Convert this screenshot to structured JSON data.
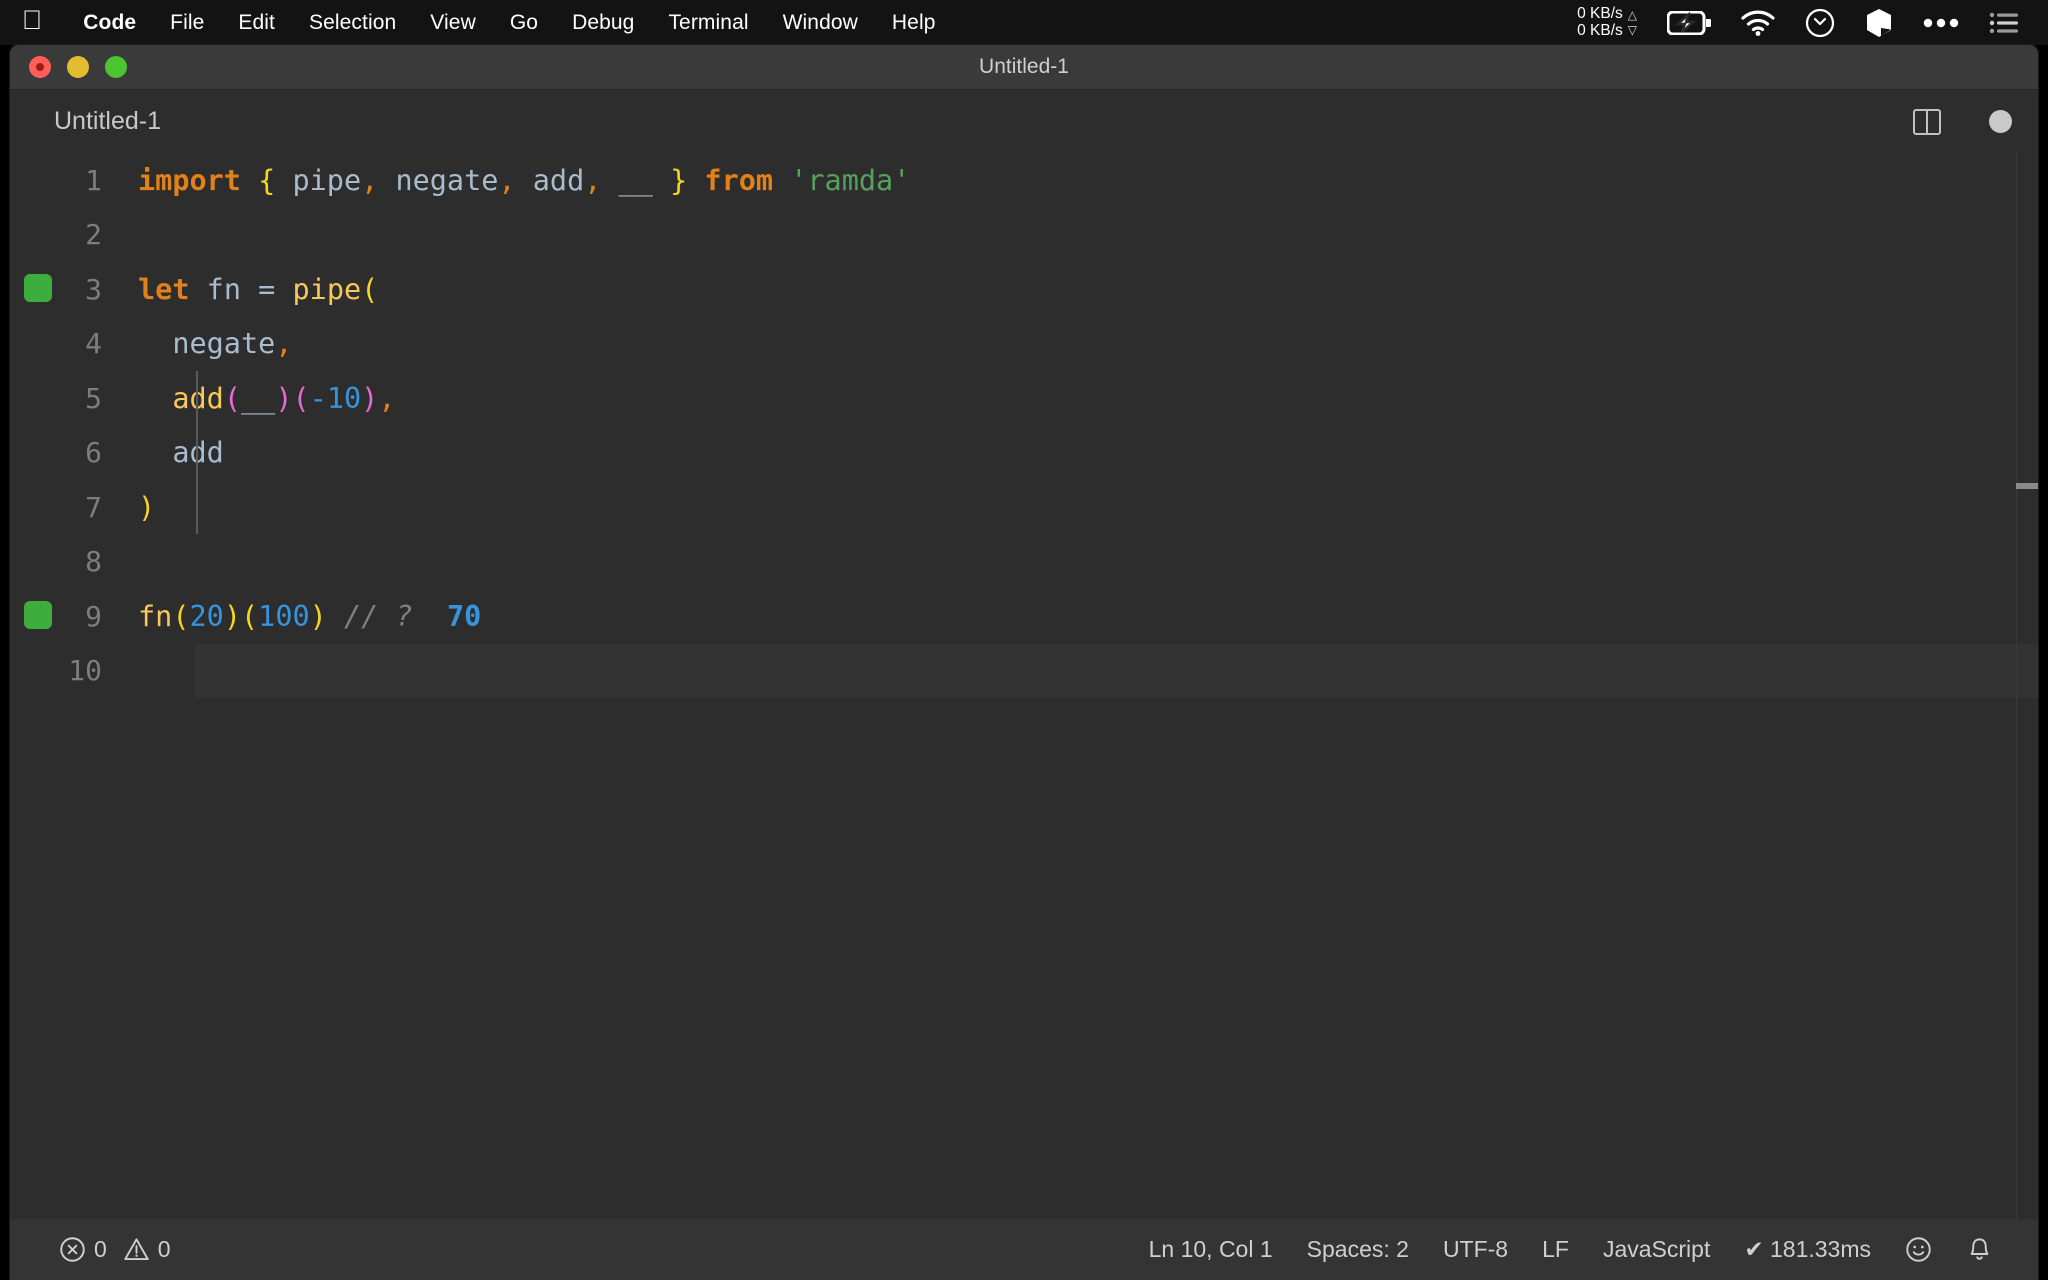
{
  "menubar": {
    "apple_icon": "apple-logo-icon",
    "items": [
      {
        "label": "Code",
        "bold": true
      },
      {
        "label": "File",
        "bold": false
      },
      {
        "label": "Edit",
        "bold": false
      },
      {
        "label": "Selection",
        "bold": false
      },
      {
        "label": "View",
        "bold": false
      },
      {
        "label": "Go",
        "bold": false
      },
      {
        "label": "Debug",
        "bold": false
      },
      {
        "label": "Terminal",
        "bold": false
      },
      {
        "label": "Window",
        "bold": false
      },
      {
        "label": "Help",
        "bold": false
      }
    ],
    "tray": {
      "net_up": "0 KB/s",
      "net_down": "0 KB/s",
      "icons": [
        "battery-charging-icon",
        "wifi-icon",
        "clock-icon",
        "box-icon",
        "ellipsis-icon",
        "control-center-icon"
      ]
    }
  },
  "window": {
    "title": "Untitled-1",
    "traffic_lights": [
      "close-button",
      "minimize-button",
      "maximize-button"
    ]
  },
  "tab": {
    "label": "Untitled-1",
    "split_icon": "split-editor-icon",
    "dirty_icon": "unsaved-dot-icon"
  },
  "editor": {
    "language": "JavaScript",
    "lines": [
      {
        "n": "1",
        "breakpoint": false,
        "active": false
      },
      {
        "n": "2",
        "breakpoint": false,
        "active": false
      },
      {
        "n": "3",
        "breakpoint": true,
        "active": false
      },
      {
        "n": "4",
        "breakpoint": false,
        "active": false
      },
      {
        "n": "5",
        "breakpoint": false,
        "active": false
      },
      {
        "n": "6",
        "breakpoint": false,
        "active": false
      },
      {
        "n": "7",
        "breakpoint": false,
        "active": false
      },
      {
        "n": "8",
        "breakpoint": false,
        "active": false
      },
      {
        "n": "9",
        "breakpoint": true,
        "active": false
      },
      {
        "n": "10",
        "breakpoint": false,
        "active": true
      }
    ],
    "code": {
      "l1": {
        "import": "import",
        "brace_open": "{",
        "pipe": "pipe",
        "c1": ",",
        "negate": "negate",
        "c2": ",",
        "add": "add",
        "c3": ",",
        "placeholder": "__",
        "brace_close": "}",
        "from": "from",
        "module": "'ramda'"
      },
      "l3": {
        "let": "let",
        "fn": "fn",
        "eq": "=",
        "pipe": "pipe",
        "paren": "("
      },
      "l4": {
        "negate": "negate",
        "comma": ","
      },
      "l5": {
        "add": "add",
        "p1": "(",
        "placeholder": "__",
        "p2": ")",
        "p3": "(",
        "num": "-10",
        "p4": ")",
        "comma": ","
      },
      "l6": {
        "add": "add"
      },
      "l7": {
        "paren": ")"
      },
      "l9": {
        "fn": "fn",
        "p1": "(",
        "n1": "20",
        "p2": ")",
        "p3": "(",
        "n2": "100",
        "p4": ")",
        "comment": "// ?",
        "result": "70"
      }
    }
  },
  "statusbar": {
    "errors": "0",
    "warnings": "0",
    "error_icon": "error-circle-icon",
    "warning_icon": "warning-triangle-icon",
    "cursor_position": "Ln 10, Col 1",
    "indentation": "Spaces: 2",
    "encoding": "UTF-8",
    "eol": "LF",
    "language": "JavaScript",
    "run_status": "✔ 181.33ms",
    "feedback_icon": "smiley-icon",
    "notifications_icon": "bell-icon"
  },
  "colors": {
    "editor_background": "#2d2d2d",
    "titlebar_background": "#3a3a3a",
    "statusbar_background": "#343434",
    "menubar_background": "#131313",
    "keyword": "#e2801a",
    "function": "#f9c859",
    "identifier": "#a9bccd",
    "string": "#58a15b",
    "number": "#3694dd",
    "bracket_yellow": "#f5d520",
    "bracket_magenta": "#e86ad4",
    "comment": "#808080",
    "breakpoint_green": "#3dae3d"
  }
}
